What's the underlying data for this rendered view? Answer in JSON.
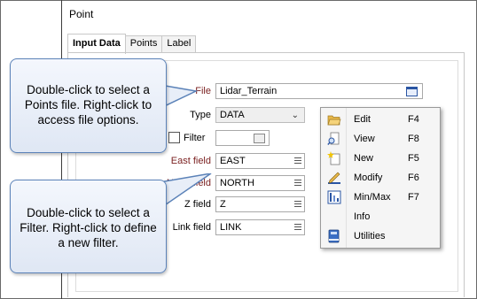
{
  "panel": {
    "title": "Point"
  },
  "tabs": [
    {
      "label": "Input Data"
    },
    {
      "label": "Points"
    },
    {
      "label": "Label"
    }
  ],
  "form": {
    "file_label": "File",
    "file_value": "Lidar_Terrain",
    "type_label": "Type",
    "type_value": "DATA",
    "filter_label": "Filter",
    "east_label": "East field",
    "east_value": "EAST",
    "north_label": "North field",
    "north_value": "NORTH",
    "z_label": "Z field",
    "z_value": "Z",
    "link_label": "Link field",
    "link_value": "LINK"
  },
  "callouts": {
    "file": "Double-click to select a Points file. Right-click to access file options.",
    "filter": "Double-click to select a Filter. Right-click to define a new filter."
  },
  "context_menu": {
    "items": [
      {
        "label": "Edit",
        "shortcut": "F4",
        "icon": "open-folder-icon"
      },
      {
        "label": "View",
        "shortcut": "F8",
        "icon": "view-document-icon"
      },
      {
        "label": "New",
        "shortcut": "F5",
        "icon": "new-document-icon"
      },
      {
        "label": "Modify",
        "shortcut": "F6",
        "icon": "modify-pencil-icon"
      },
      {
        "label": "Min/Max",
        "shortcut": "F7",
        "icon": "min-max-icon"
      },
      {
        "label": "Info",
        "shortcut": "",
        "icon": ""
      },
      {
        "label": "Utilities",
        "shortcut": "",
        "icon": "utilities-book-icon"
      }
    ]
  },
  "colors": {
    "label_red": "#7a1f1f",
    "callout_border": "#5b82b8",
    "icon_blue": "#2a55a3"
  }
}
